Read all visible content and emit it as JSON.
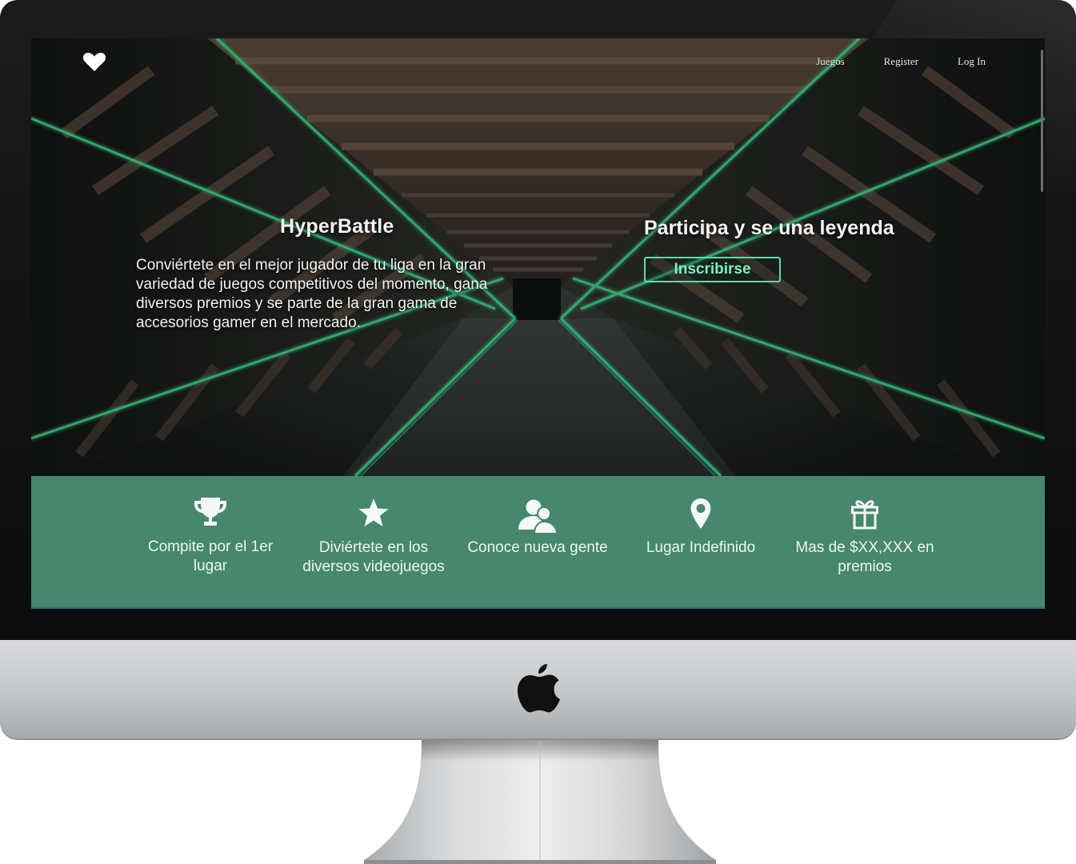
{
  "nav": {
    "brand_icon": "heart-icon",
    "links": [
      "Juegos",
      "Register",
      "Log In"
    ]
  },
  "hero": {
    "title": "HyperBattle",
    "description": "Conviértete en el mejor jugador de tu liga en la gran variedad de juegos competitivos del momento, gana diversos premios y se parte de la gran gama de accesorios gamer en el mercado.",
    "cta_title": "Participa y se una leyenda",
    "cta_button": "Inscribirse"
  },
  "features": [
    {
      "icon": "trophy-icon",
      "label": "Compite por el 1er lugar"
    },
    {
      "icon": "star-icon",
      "label": "Diviértete en los diversos videojuegos"
    },
    {
      "icon": "people-icon",
      "label": "Conoce nueva gente"
    },
    {
      "icon": "location-pin-icon",
      "label": "Lugar Indefinido"
    },
    {
      "icon": "gift-icon",
      "label": "Mas de $XX,XXX en premios"
    }
  ],
  "colors": {
    "feature_band": "#46876d",
    "accent": "#5fdcae",
    "neon_line": "#3fd38a"
  },
  "device": {
    "logo_icon": "apple-logo-icon"
  }
}
